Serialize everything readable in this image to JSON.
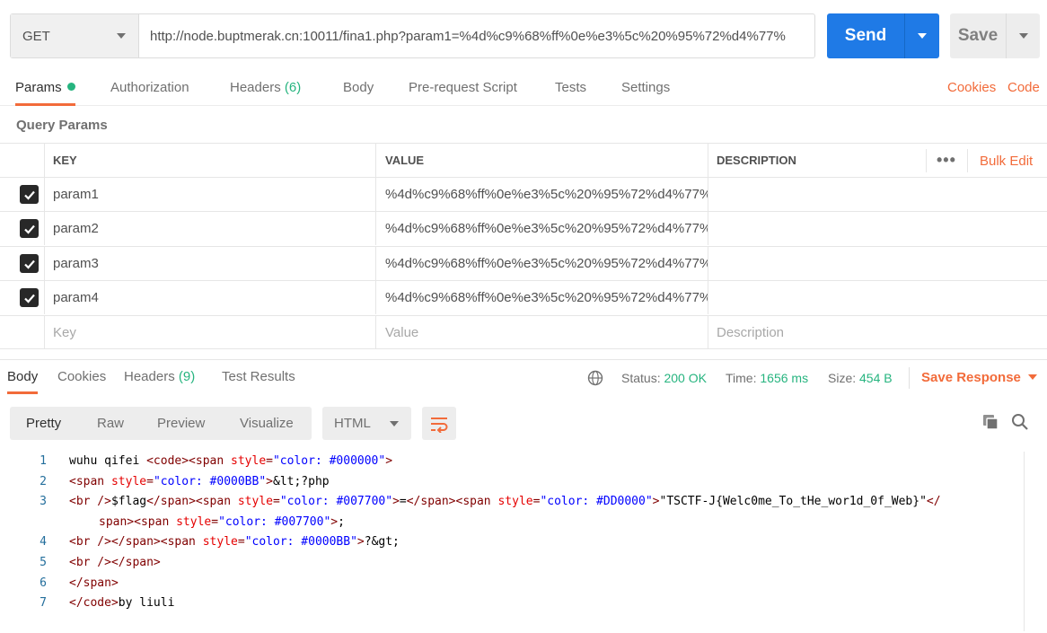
{
  "request": {
    "method": "GET",
    "url": "http://node.buptmerak.cn:10011/fina1.php?param1=%4d%c9%68%ff%0e%e3%5c%20%95%72%d4%77%",
    "send_label": "Send",
    "save_label": "Save"
  },
  "req_tabs": {
    "params": "Params",
    "authorization": "Authorization",
    "headers": "Headers",
    "headers_count": "(6)",
    "body": "Body",
    "prerequest": "Pre-request Script",
    "tests": "Tests",
    "settings": "Settings",
    "cookies": "Cookies",
    "code": "Code"
  },
  "query_params": {
    "title": "Query Params",
    "columns": {
      "key": "KEY",
      "value": "VALUE",
      "description": "DESCRIPTION"
    },
    "more": "•••",
    "bulk_edit": "Bulk Edit",
    "rows": [
      {
        "key": "param1",
        "value": "%4d%c9%68%ff%0e%e3%5c%20%95%72%d4%77%",
        "checked": true
      },
      {
        "key": "param2",
        "value": "%4d%c9%68%ff%0e%e3%5c%20%95%72%d4%77%",
        "checked": true
      },
      {
        "key": "param3",
        "value": "%4d%c9%68%ff%0e%e3%5c%20%95%72%d4%77%",
        "checked": true
      },
      {
        "key": "param4",
        "value": "%4d%c9%68%ff%0e%e3%5c%20%95%72%d4%77%",
        "checked": true
      }
    ],
    "placeholders": {
      "key": "Key",
      "value": "Value",
      "description": "Description"
    }
  },
  "response": {
    "tabs": {
      "body": "Body",
      "cookies": "Cookies",
      "headers": "Headers",
      "headers_count": "(9)",
      "test_results": "Test Results"
    },
    "status_label": "Status:",
    "status_value": "200 OK",
    "time_label": "Time:",
    "time_value": "1656 ms",
    "size_label": "Size:",
    "size_value": "454 B",
    "save_response": "Save Response",
    "views": {
      "pretty": "Pretty",
      "raw": "Raw",
      "preview": "Preview",
      "visualize": "Visualize"
    },
    "format": "HTML"
  },
  "code_lines": [
    {
      "n": "1",
      "parts": [
        [
          "txt",
          "wuhu qifei "
        ],
        [
          "tag",
          "<code><span "
        ],
        [
          "attr",
          "style"
        ],
        [
          "tag",
          "="
        ],
        [
          "str",
          "\"color: #000000\""
        ],
        [
          "tag",
          ">"
        ]
      ]
    },
    {
      "n": "2",
      "parts": [
        [
          "tag",
          "<span "
        ],
        [
          "attr",
          "style"
        ],
        [
          "tag",
          "="
        ],
        [
          "str",
          "\"color: #0000BB\""
        ],
        [
          "tag",
          ">"
        ],
        [
          "txt",
          "&lt;?php"
        ]
      ]
    },
    {
      "n": "3",
      "parts": [
        [
          "tag",
          "<br />"
        ],
        [
          "txt",
          "$flag"
        ],
        [
          "tag",
          "</span><span "
        ],
        [
          "attr",
          "style"
        ],
        [
          "tag",
          "="
        ],
        [
          "str",
          "\"color: #007700\""
        ],
        [
          "tag",
          ">"
        ],
        [
          "txt",
          "="
        ],
        [
          "tag",
          "</span><span "
        ],
        [
          "attr",
          "style"
        ],
        [
          "tag",
          "="
        ],
        [
          "str",
          "\"color: #DD0000\""
        ],
        [
          "tag",
          ">"
        ],
        [
          "txt",
          "\"TSCTF-J{Welc0me_To_tHe_wor1d_0f_Web}\""
        ],
        [
          "tag",
          "</"
        ]
      ],
      "cont": [
        [
          "tag",
          "span><span "
        ],
        [
          "attr",
          "style"
        ],
        [
          "tag",
          "="
        ],
        [
          "str",
          "\"color: #007700\""
        ],
        [
          "tag",
          ">"
        ],
        [
          "txt",
          ";"
        ]
      ]
    },
    {
      "n": "4",
      "parts": [
        [
          "tag",
          "<br /></span><span "
        ],
        [
          "attr",
          "style"
        ],
        [
          "tag",
          "="
        ],
        [
          "str",
          "\"color: #0000BB\""
        ],
        [
          "tag",
          ">"
        ],
        [
          "txt",
          "?&gt;"
        ]
      ]
    },
    {
      "n": "5",
      "parts": [
        [
          "tag",
          "<br /></span>"
        ]
      ]
    },
    {
      "n": "6",
      "parts": [
        [
          "tag",
          "</span>"
        ]
      ]
    },
    {
      "n": "7",
      "parts": [
        [
          "tag",
          "</code>"
        ],
        [
          "txt",
          "by liuli"
        ]
      ]
    }
  ]
}
